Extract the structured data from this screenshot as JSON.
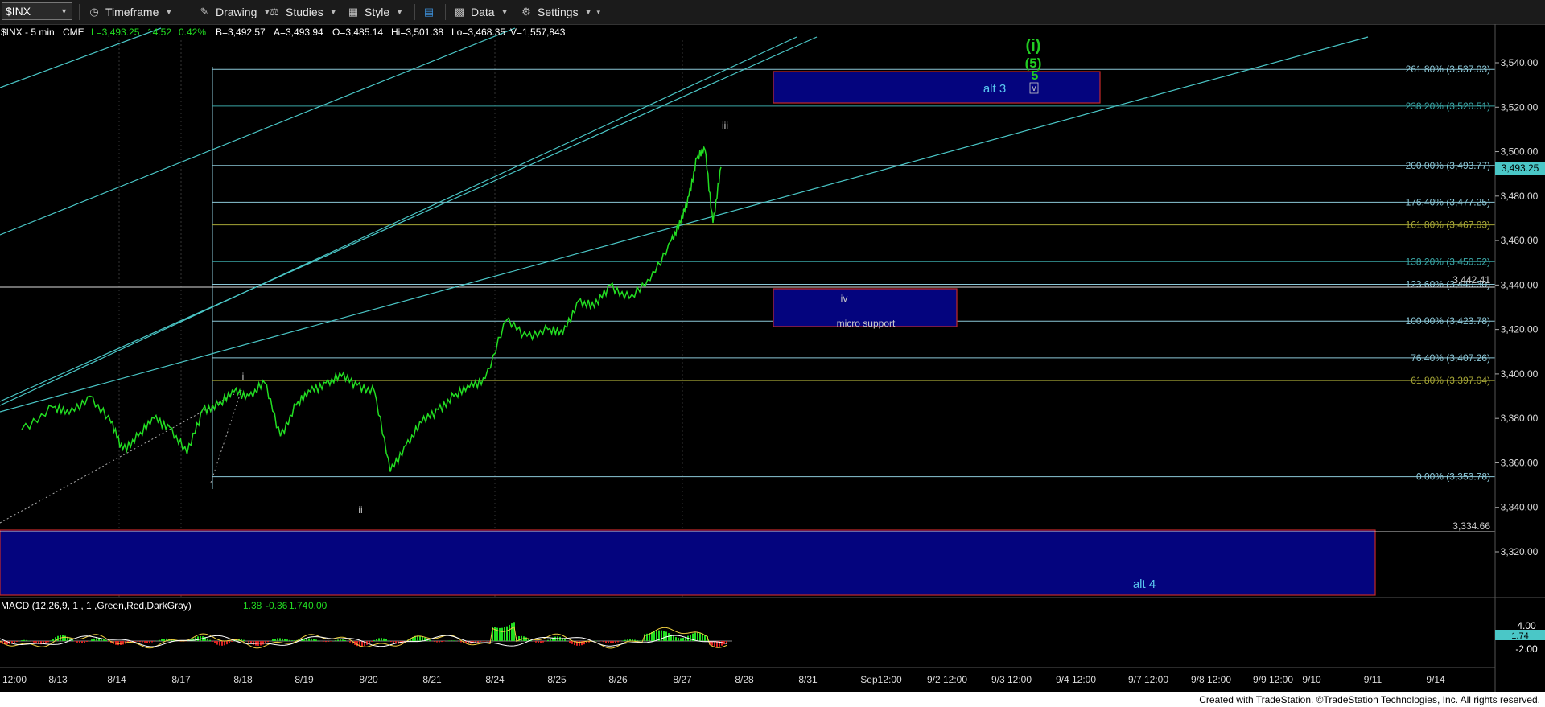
{
  "toolbar": {
    "symbol": "$INX",
    "timeframe": "Timeframe",
    "drawing": "Drawing",
    "studies": "Studies",
    "style": "Style",
    "data": "Data",
    "settings": "Settings"
  },
  "info_line": {
    "symbol": "$INX - 5 min",
    "exchange": "CME",
    "last": "L=3,493.25",
    "change": "14.52",
    "change_pct": "0.42%",
    "bid": "B=3,492.57",
    "ask": "A=3,493.94",
    "open": "O=3,485.14",
    "high": "Hi=3,501.38",
    "low": "Lo=3,468.35",
    "volume": "V=1,557,843"
  },
  "price_axis": {
    "ticks": [
      "3,540.00",
      "3,520.00",
      "3,500.00",
      "3,480.00",
      "3,460.00",
      "3,440.00",
      "3,420.00",
      "3,400.00",
      "3,380.00",
      "3,360.00",
      "3,340.00",
      "3,320.00"
    ],
    "current_price": "3,493.25",
    "current_price_color": "#4ac7c7"
  },
  "fib_levels": [
    {
      "label": "261.80% (3,537.03)",
      "price": 3537.03,
      "color": "#8cc8d8"
    },
    {
      "label": "238.20% (3,520.51)",
      "price": 3520.51,
      "color": "#3aa6a6"
    },
    {
      "label": "200.00% (3,493.77)",
      "price": 3493.77,
      "color": "#8cc8d8"
    },
    {
      "label": "176.40% (3,477.25)",
      "price": 3477.25,
      "color": "#8cc8d8"
    },
    {
      "label": "161.80% (3,467.03)",
      "price": 3467.03,
      "color": "#a6a636"
    },
    {
      "label": "138.20% (3,450.52)",
      "price": 3450.52,
      "color": "#3aa6a6"
    },
    {
      "label": "123.60% (3,440.30)",
      "price": 3440.3,
      "color": "#8cc8d8"
    },
    {
      "label": "100.00% (3,423.78)",
      "price": 3423.78,
      "color": "#8cc8d8"
    },
    {
      "label": "76.40% (3,407.26)",
      "price": 3407.26,
      "color": "#8cc8d8"
    },
    {
      "label": "61.80% (3,397.04)",
      "price": 3397.04,
      "color": "#a6a636"
    },
    {
      "label": "0.00% (3,353.78)",
      "price": 3353.78,
      "color": "#8cc8d8"
    }
  ],
  "extra_levels": {
    "horizontal_label": "3,442.41",
    "alt4_level": "3,334.66"
  },
  "annotations": {
    "wave_i_green": "(i)",
    "wave_5_paren": "(5)",
    "wave_5": "5",
    "wave_v": "v",
    "alt3": "alt 3",
    "alt4": "alt 4",
    "iii": "iii",
    "iv": "iv",
    "i": "i",
    "ii": "ii",
    "micro_support": "micro support"
  },
  "macd": {
    "title": "MACD (12,26,9, 1 , 1 ,Green,Red,DarkGray)",
    "v1": "1.38",
    "v2": "-0.36",
    "v3": "1.74",
    "v4": "0.00",
    "axis_top": "4.00",
    "axis_current": "1.74",
    "axis_bottom": "-2.00"
  },
  "time_axis": [
    "12:00",
    "8/13",
    "8/14",
    "8/17",
    "8/18",
    "8/19",
    "8/20",
    "8/21",
    "8/24",
    "8/25",
    "8/26",
    "8/27",
    "8/28",
    "8/31",
    "Sep12:00",
    "9/2 12:00",
    "9/3 12:00",
    "9/4 12:00",
    "9/7 12:00",
    "9/8 12:00",
    "9/9 12:00",
    "9/10",
    "9/11",
    "9/14"
  ],
  "footer": "Created with TradeStation. ©TradeStation Technologies, Inc. All rights reserved.",
  "chart_data": {
    "type": "line",
    "title": "$INX - 5 min",
    "ylim": [
      3310,
      3548
    ],
    "price_path": [
      [
        "8/12",
        3375
      ],
      [
        "8/12",
        3385
      ],
      [
        "8/13",
        3382
      ],
      [
        "8/13",
        3390
      ],
      [
        "8/13",
        3378
      ],
      [
        "8/14",
        3366
      ],
      [
        "8/14",
        3372
      ],
      [
        "8/14",
        3380
      ],
      [
        "8/14",
        3376
      ],
      [
        "8/17",
        3364
      ],
      [
        "8/17",
        3384
      ],
      [
        "8/17",
        3386
      ],
      [
        "8/17",
        3392
      ],
      [
        "8/18",
        3390
      ],
      [
        "8/18",
        3396
      ],
      [
        "8/18",
        3372
      ],
      [
        "8/18",
        3386
      ],
      [
        "8/19",
        3392
      ],
      [
        "8/19",
        3396
      ],
      [
        "8/19",
        3399
      ],
      [
        "8/19",
        3395
      ],
      [
        "8/20",
        3392
      ],
      [
        "8/20",
        3356
      ],
      [
        "8/20",
        3368
      ],
      [
        "8/20",
        3378
      ],
      [
        "8/21",
        3384
      ],
      [
        "8/21",
        3390
      ],
      [
        "8/21",
        3394
      ],
      [
        "8/21",
        3398
      ],
      [
        "8/24",
        3424
      ],
      [
        "8/24",
        3417
      ],
      [
        "8/24",
        3420
      ],
      [
        "8/25",
        3418
      ],
      [
        "8/25",
        3433
      ],
      [
        "8/25",
        3430
      ],
      [
        "8/25",
        3440
      ],
      [
        "8/26",
        3434
      ],
      [
        "8/26",
        3442
      ],
      [
        "8/26",
        3460
      ],
      [
        "8/27",
        3468
      ],
      [
        "8/27",
        3480
      ],
      [
        "8/27",
        3497
      ],
      [
        "8/27",
        3501
      ],
      [
        "8/27",
        3468
      ],
      [
        "8/27",
        3493
      ]
    ]
  }
}
